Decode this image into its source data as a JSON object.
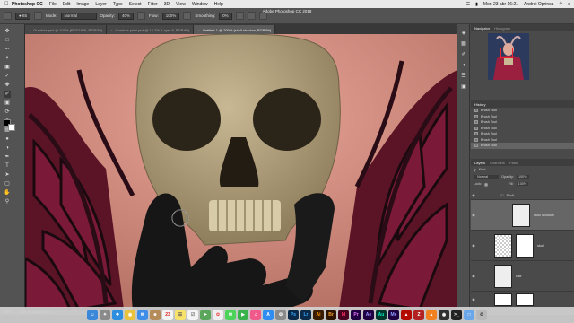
{
  "menubar": {
    "app_name": "Photoshop CC",
    "items": [
      "File",
      "Edit",
      "Image",
      "Layer",
      "Type",
      "Select",
      "Filter",
      "3D",
      "View",
      "Window",
      "Help"
    ],
    "datetime": "Mon 23 abr 16:21",
    "user": "Andrei Oprinca"
  },
  "options": {
    "window_title": "Adobe Photoshop CC 2018",
    "mode_label": "Mode:",
    "mode_value": "Normal",
    "opacity_label": "Opacity:",
    "opacity_value": "40%",
    "flow_label": "Flow:",
    "flow_value": "100%",
    "smoothing_label": "Smoothing:",
    "smoothing_value": "0%"
  },
  "tabs": [
    {
      "label": "Gundula.psd @ 100% (RED1806, RGB/8#)"
    },
    {
      "label": "Gundula-print.psd @ 16,7% (Layer 8, RGB/8#)"
    },
    {
      "label": "Untitled-1 @ 200% (skull shadow, RGB/8#)"
    }
  ],
  "panels": {
    "navigator_tab": "Navigator",
    "histogram_tab": "Histogram",
    "history_tab": "History",
    "history_items": [
      "Brush Tool",
      "Brush Tool",
      "Brush Tool",
      "Brush Tool",
      "Brush Tool",
      "Brush Tool",
      "Brush Tool"
    ],
    "layers_tab": "Layers",
    "channels_tab": "Channels",
    "paths_tab": "Paths",
    "kind_label": "Kind",
    "blend_value": "Normal",
    "opacity_label": "Opacity:",
    "opacity_value": "100%",
    "lock_label": "Lock:",
    "fill_label": "Fill:",
    "fill_value": "100%",
    "layers": [
      {
        "name": "Skull"
      },
      {
        "name": "skull shadow"
      },
      {
        "name": "skull"
      },
      {
        "name": "hair"
      }
    ]
  },
  "status": {
    "zoom": "200%",
    "doc": "Doc: 56,3M/1022,4M"
  },
  "dock_apps": [
    "Finder",
    "Launchpad",
    "Safari",
    "Chrome",
    "Mail",
    "Contacts",
    "Calendar",
    "Notes",
    "Reminders",
    "Maps",
    "Photos",
    "Messages",
    "FaceTime",
    "iTunes",
    "App Store",
    "System Preferences",
    "Photoshop",
    "Lightroom",
    "Illustrator",
    "Bridge",
    "InDesign",
    "Premiere",
    "After Effects",
    "Audition",
    "Media Encoder",
    "Acrobat",
    "FileZilla",
    "VLC",
    "OBS",
    "Terminal",
    "Folder",
    "Trash"
  ]
}
